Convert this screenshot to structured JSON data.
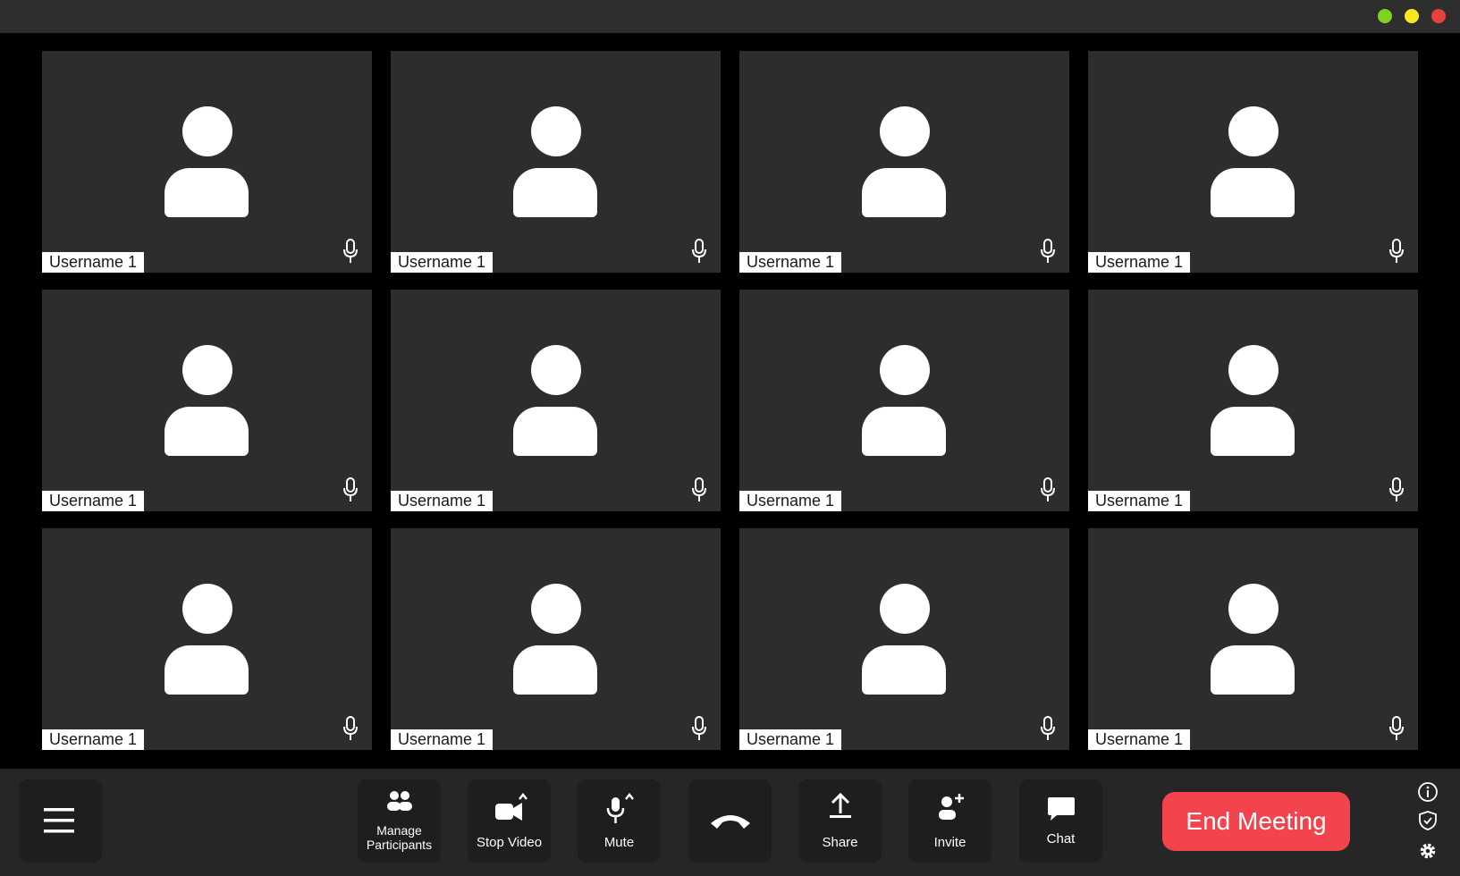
{
  "window": {
    "traffic_lights": [
      {
        "name": "green",
        "color": "#7ed321"
      },
      {
        "name": "yellow",
        "color": "#f8e71c"
      },
      {
        "name": "red",
        "color": "#e8403c"
      }
    ]
  },
  "participants": [
    {
      "name": "Username 1"
    },
    {
      "name": "Username 1"
    },
    {
      "name": "Username 1"
    },
    {
      "name": "Username 1"
    },
    {
      "name": "Username 1"
    },
    {
      "name": "Username 1"
    },
    {
      "name": "Username 1"
    },
    {
      "name": "Username 1"
    },
    {
      "name": "Username 1"
    },
    {
      "name": "Username 1"
    },
    {
      "name": "Username 1"
    },
    {
      "name": "Username 1"
    }
  ],
  "toolbar": {
    "menu_icon": "hamburger-menu-icon",
    "manage_participants_label": "Manage\nParticipants",
    "stop_video_label": "Stop Video",
    "mute_label": "Mute",
    "hangup_icon": "phone-hangup-icon",
    "share_label": "Share",
    "invite_label": "Invite",
    "chat_label": "Chat",
    "end_meeting_label": "End Meeting",
    "end_meeting_color": "#f3434c"
  },
  "side_icons": [
    "info-icon",
    "shield-icon",
    "gear-icon"
  ]
}
